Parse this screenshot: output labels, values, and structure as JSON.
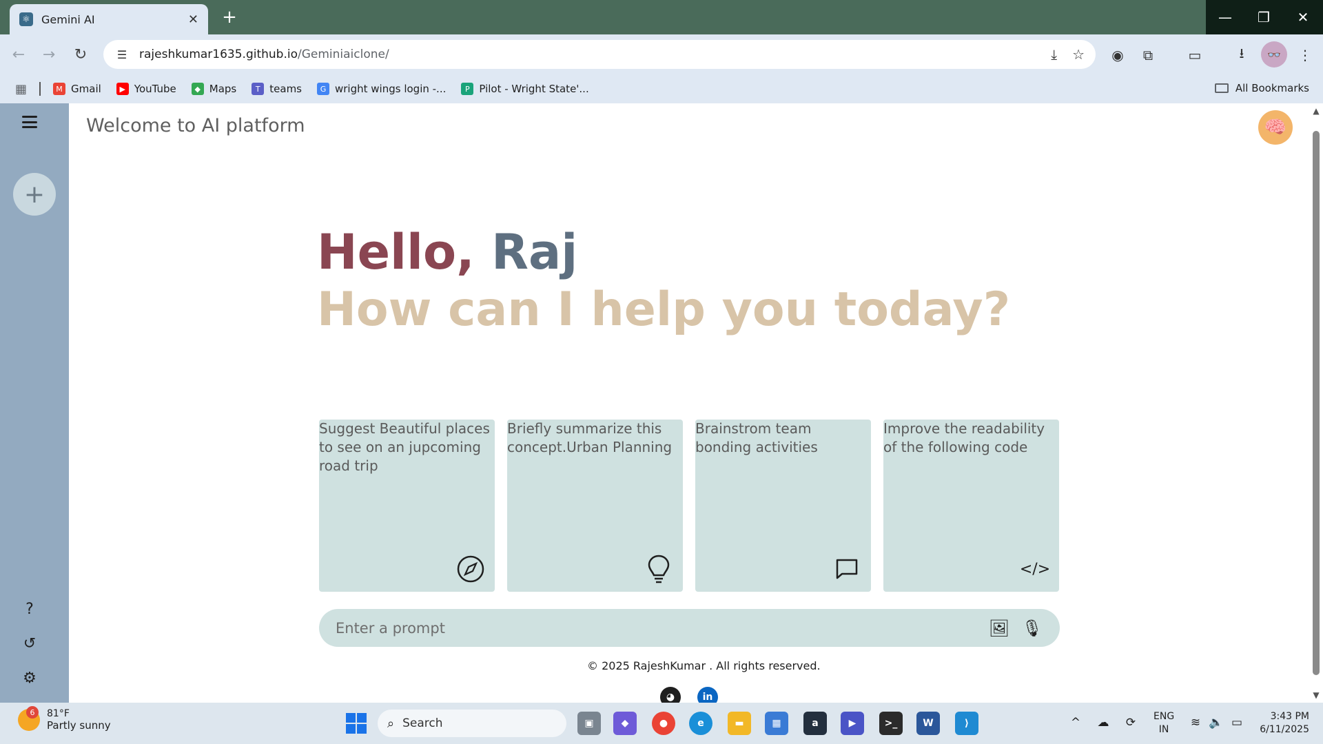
{
  "browser": {
    "tab_title": "Gemini AI",
    "url_host": "rajeshkumar1635.github.io",
    "url_path": "/Geminiaiclone/",
    "bookmarks": [
      {
        "label": "Gmail",
        "color": "#ea4335"
      },
      {
        "label": "YouTube",
        "color": "#ff0000"
      },
      {
        "label": "Maps",
        "color": "#34a853"
      },
      {
        "label": "teams",
        "color": "#5b5fc7"
      },
      {
        "label": "wright wings login -...",
        "color": "#4285f4"
      },
      {
        "label": "Pilot - Wright State'...",
        "color": "#1aa37a"
      }
    ],
    "all_bookmarks": "All Bookmarks"
  },
  "page": {
    "title": "Welcome to AI platform",
    "greeting_hello": "Hello, ",
    "greeting_name": "Raj",
    "subtitle": "How can I help you today?",
    "cards": [
      {
        "text": "Suggest Beautiful places to see on an jupcoming road trip",
        "icon": "compass-icon"
      },
      {
        "text": "Briefly summarize this concept.Urban Planning",
        "icon": "bulb-icon"
      },
      {
        "text": "Brainstrom team bonding activities",
        "icon": "message-icon"
      },
      {
        "text": "Improve the readability of the following code",
        "icon": "code-icon"
      }
    ],
    "prompt_placeholder": "Enter a prompt",
    "footer": "© 2025 RajeshKumar . All rights reserved."
  },
  "taskbar": {
    "weather_badge": "6",
    "weather_temp": "81°F",
    "weather_desc": "Partly sunny",
    "search_label": "Search",
    "lang_line1": "ENG",
    "lang_line2": "IN",
    "time": "3:43 PM",
    "date": "6/11/2025"
  },
  "colors": {
    "sidebar": "#93aac0",
    "card_bg": "#cfe1e0",
    "hello": "#8a4652",
    "name": "#5e6f80",
    "subtitle": "#d8c4a8"
  }
}
